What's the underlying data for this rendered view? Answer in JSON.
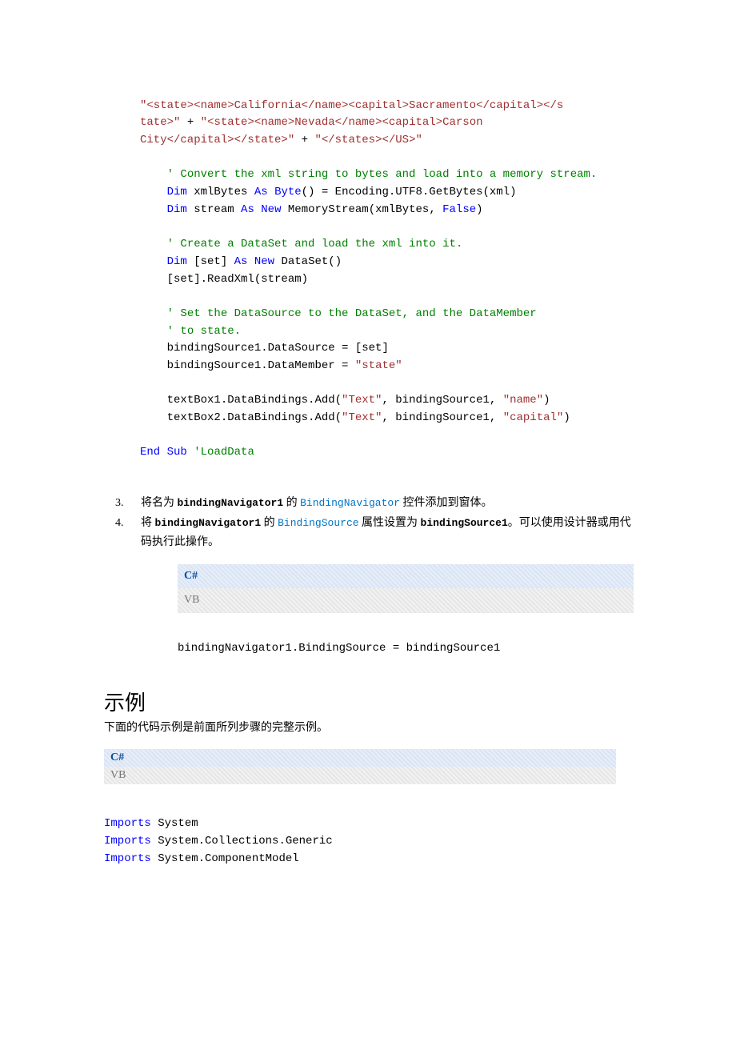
{
  "code1": {
    "l1a": "\"<state><name>California</name><capital>Sacramento</capital></s",
    "l1b": "tate>\"",
    "l1c": " + ",
    "l1d": "\"<state><name>Nevada</name><capital>Carson ",
    "l1e": "City</capital></state>\"",
    "l1f": " + ",
    "l1g": "\"</states></US>\"",
    "c1": "' Convert the xml string to bytes and load into a memory stream.",
    "l2a": "Dim",
    "l2b": " xmlBytes ",
    "l2c": "As",
    "l2d": " ",
    "l2e": "Byte",
    "l2f": "() = Encoding.UTF8.GetBytes(xml)",
    "l3a": "Dim",
    "l3b": " stream ",
    "l3c": "As",
    "l3d": " ",
    "l3e": "New",
    "l3f": " MemoryStream(xmlBytes, ",
    "l3g": "False",
    "l3h": ")",
    "c2": "' Create a DataSet and load the xml into it.",
    "l4a": "Dim",
    "l4b": " [set] ",
    "l4c": "As",
    "l4d": " ",
    "l4e": "New",
    "l4f": " DataSet()",
    "l5": "[set].ReadXml(stream)",
    "c3": "' Set the DataSource to the DataSet, and the DataMember",
    "c4": "' to state.",
    "l6": "bindingSource1.DataSource = [set]",
    "l7a": "bindingSource1.DataMember = ",
    "l7b": "\"state\"",
    "l8a": "textBox1.DataBindings.Add(",
    "l8b": "\"Text\"",
    "l8c": ", bindingSource1, ",
    "l8d": "\"name\"",
    "l8e": ")",
    "l9a": "textBox2.DataBindings.Add(",
    "l9b": "\"Text\"",
    "l9c": ", bindingSource1, ",
    "l9d": "\"capital\"",
    "l9e": ")",
    "l10a": "End",
    "l10b": " ",
    "l10c": "Sub",
    "l10d": " ",
    "l10e": "'LoadData"
  },
  "list": {
    "i3_a": "将名为 ",
    "i3_code1": "bindingNavigator1",
    "i3_b": " 的 ",
    "i3_link": "BindingNavigator",
    "i3_c": " 控件添加到窗体。",
    "i4_a": "将 ",
    "i4_code1": "bindingNavigator1",
    "i4_b": " 的 ",
    "i4_link": "BindingSource",
    "i4_c": " 属性设置为 ",
    "i4_code2": "bindingSource1",
    "i4_d": "。可以使用设计器或用代码执行此操作。"
  },
  "tabs": {
    "csharp": "C#",
    "vb": "VB"
  },
  "code2": "bindingNavigator1.BindingSource = bindingSource1",
  "example": {
    "title": "示例",
    "sub": "下面的代码示例是前面所列步骤的完整示例。"
  },
  "code3": {
    "kw": "Imports",
    "l1": " System",
    "l2": " System.Collections.Generic",
    "l3": " System.ComponentModel"
  }
}
